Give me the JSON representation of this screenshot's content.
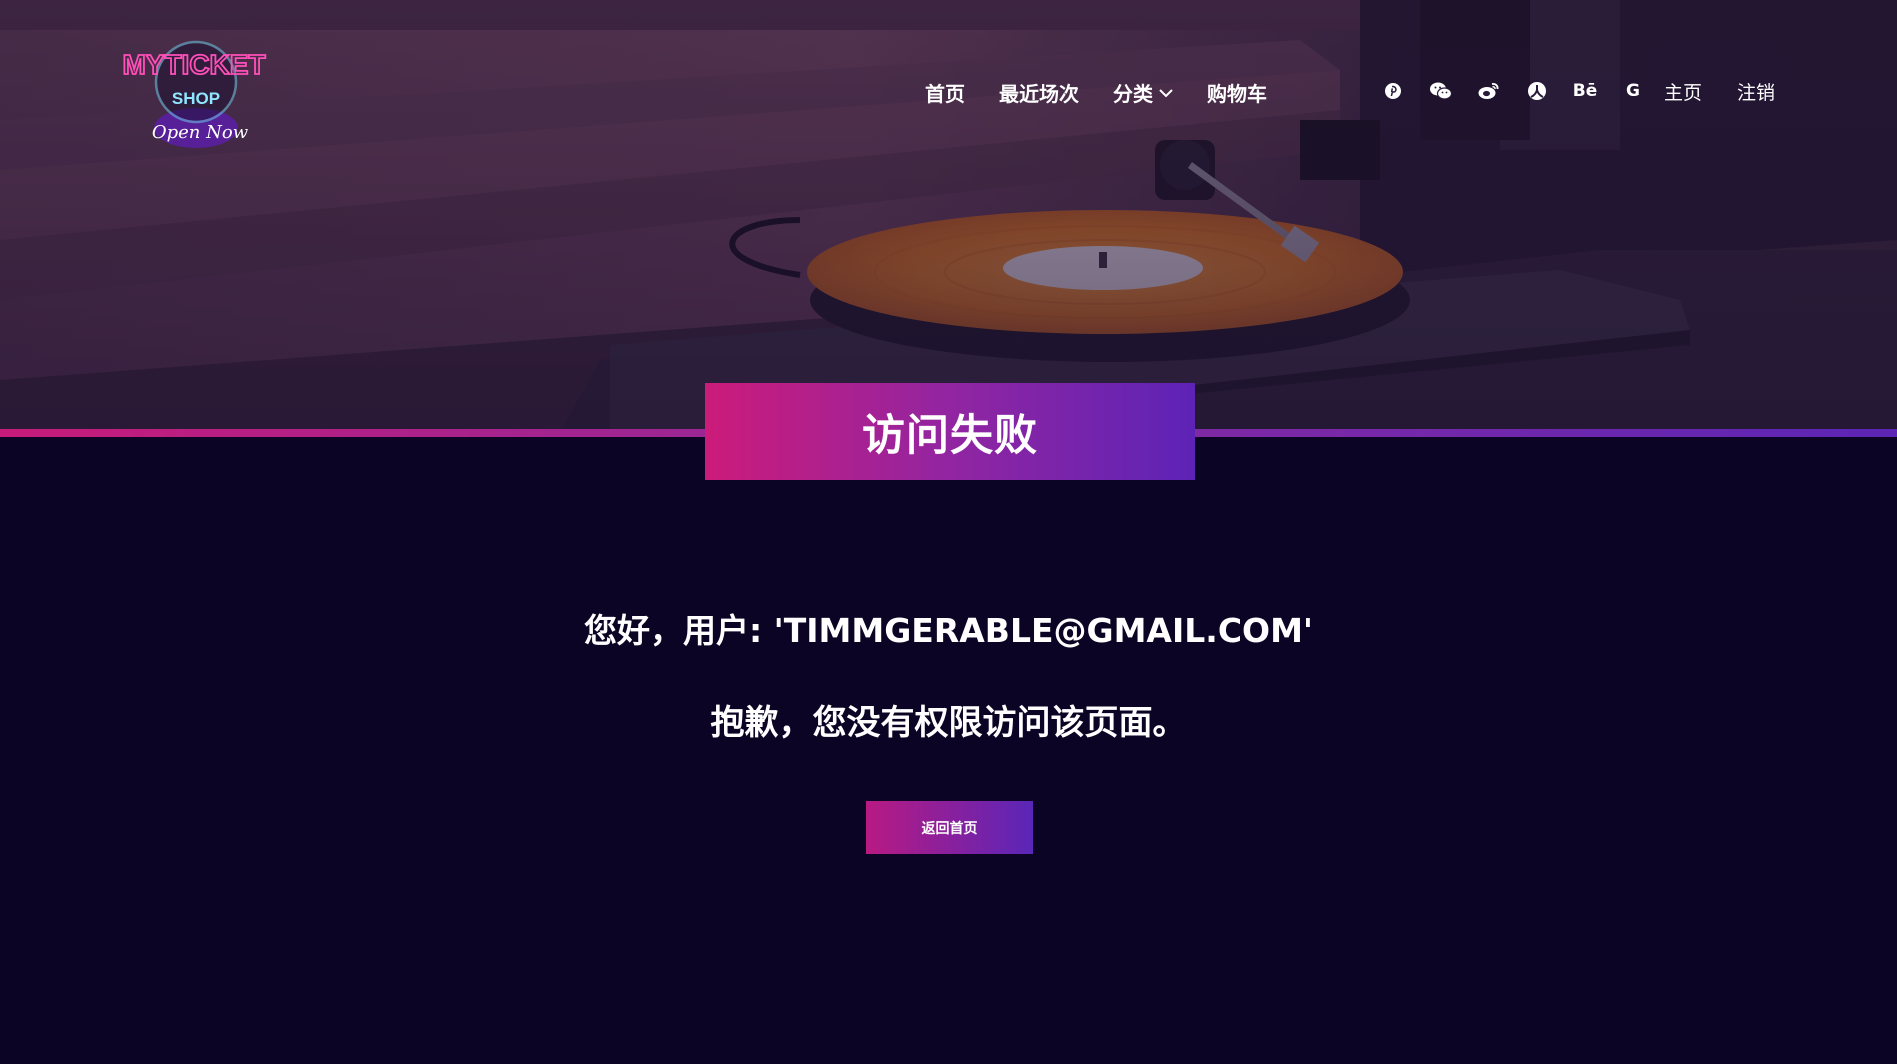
{
  "header": {
    "logo": {
      "line1": "MYTICKET",
      "line2": "SHOP",
      "line3": "Open Now"
    },
    "nav": [
      {
        "label": "首页"
      },
      {
        "label": "最近场次"
      },
      {
        "label": "分类",
        "has_dropdown": true
      },
      {
        "label": "购物车"
      }
    ],
    "social_icons": [
      "pinterest-icon",
      "wechat-icon",
      "weibo-icon",
      "renren-icon",
      "behance-icon",
      "google-icon"
    ],
    "social_glyphs": {
      "behance": "Bē",
      "google": "G"
    },
    "home_link": "主页",
    "logout_link": "注销"
  },
  "banner": {
    "title": "访问失败"
  },
  "main": {
    "greeting": "您好，用户: 'TIMMGERABLE@GMAIL.COM'",
    "message": "抱歉，您没有权限访问该页面。",
    "back_button": "返回首页"
  },
  "colors": {
    "background": "#0c0424",
    "gradient_start": "#cc1b7a",
    "gradient_end": "#5d23b6",
    "vinyl_orange": "#e8801e"
  }
}
